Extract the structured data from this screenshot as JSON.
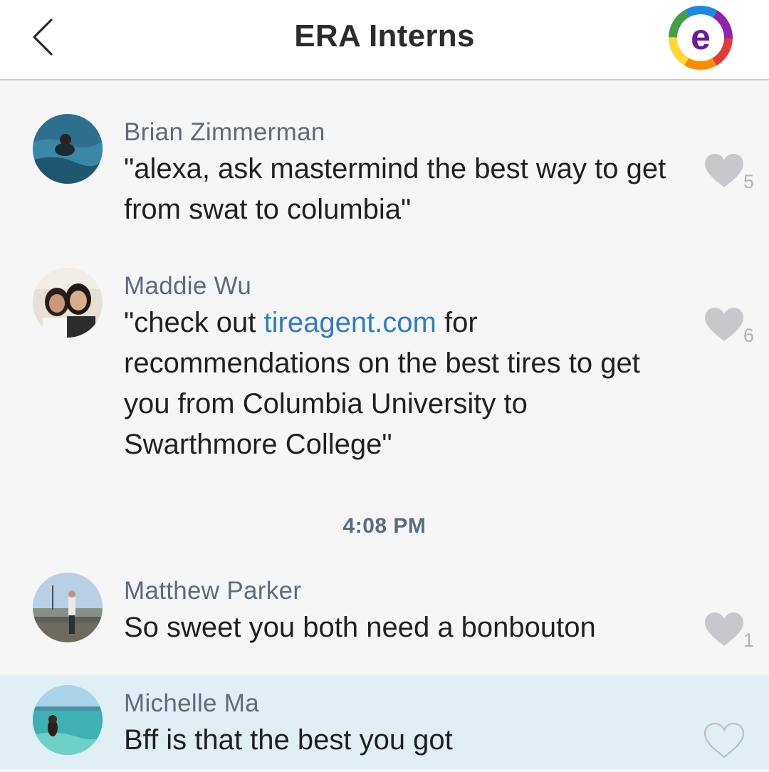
{
  "header": {
    "title": "ERA Interns",
    "back_icon": "chevron-left-icon",
    "logo_letter": "e"
  },
  "messages": [
    {
      "sender": "Brian Zimmerman",
      "text": "\"alexa, ask mastermind the best way to get from swat to columbia\"",
      "likes": "5",
      "liked": true
    },
    {
      "sender": "Maddie Wu",
      "text_before": "\"check out ",
      "link": "tireagent.com",
      "text_after": " for recommendations on the best tires to get you from Columbia University to Swarthmore College\"",
      "likes": "6",
      "liked": true
    },
    {
      "sender": "Matthew Parker",
      "text": "So sweet you both need a bonbouton",
      "likes": "1",
      "liked": true
    },
    {
      "sender": "Michelle Ma",
      "text": "Bff is that the best you got",
      "likes": "",
      "liked": false
    }
  ],
  "timestamp": "4:08 PM",
  "colors": {
    "link": "#2f7cc1",
    "sender": "#5d6b7e",
    "highlight_row": "#e0eef6",
    "heart_filled": "#c8c8cc"
  }
}
